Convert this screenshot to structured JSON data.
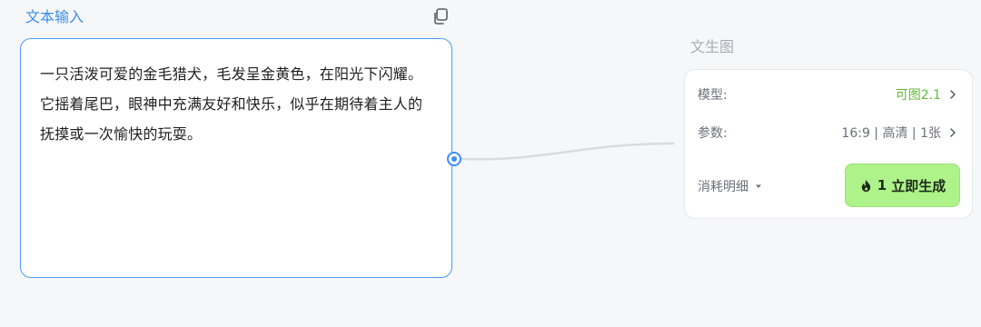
{
  "text_input_node": {
    "title": "文本输入",
    "prompt": "一只活泼可爱的金毛猎犬，毛发呈金黄色，在阳光下闪耀。它摇着尾巴，眼神中充满友好和快乐，似乎在期待着主人的抚摸或一次愉快的玩耍。",
    "copy_icon": "copy-icon"
  },
  "text_to_image_node": {
    "title": "文生图",
    "model_label": "模型:",
    "model_value": "可图2.1",
    "params_label": "参数:",
    "params_value": "16:9 | 高清 | 1张",
    "cost_detail_label": "消耗明细",
    "generate_button": {
      "count": "1",
      "label": "立即生成",
      "icon": "flame-icon"
    }
  },
  "colors": {
    "accent_blue": "#3b8ff0",
    "model_green": "#63b83c",
    "button_green": "#aef28a",
    "background": "#f6f7f9"
  }
}
